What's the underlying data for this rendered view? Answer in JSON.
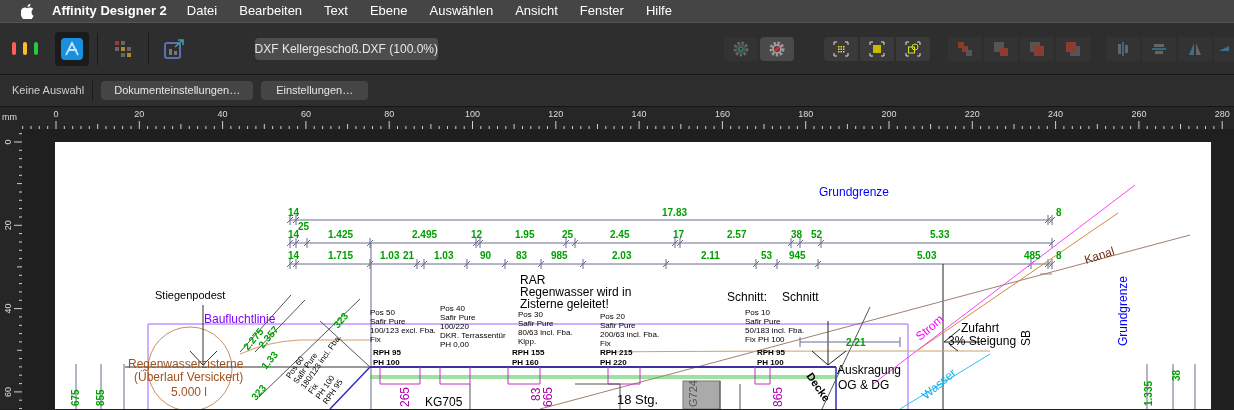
{
  "menu_bar": {
    "app_name": "Affinity Designer 2",
    "items": [
      "Datei",
      "Bearbeiten",
      "Text",
      "Ebene",
      "Auswählen",
      "Ansicht",
      "Fenster",
      "Hilfe"
    ]
  },
  "toolbar": {
    "personas": [
      {
        "selected": true
      },
      {
        "selected": false
      },
      {
        "selected": false
      }
    ],
    "document_title": "DXF Kellergeschoß.DXF (100.0%)",
    "snapping_buttons": [
      {
        "selected": false
      },
      {
        "selected": true
      }
    ]
  },
  "context_bar": {
    "status": "Keine Auswahl",
    "buttons": [
      "Dokumenteinstellungen…",
      "Einstellungen…"
    ]
  },
  "ruler": {
    "unit": "mm",
    "horizontal_labels": [
      "0",
      "20",
      "40",
      "60",
      "80",
      "100",
      "120",
      "140",
      "160",
      "180",
      "200",
      "220",
      "240",
      "260",
      "280"
    ],
    "vertical_labels": [
      "0",
      "20",
      "40",
      "60"
    ]
  },
  "drawing": {
    "labels": [
      {
        "text": "Grundgrenze",
        "color": "#0000ff"
      },
      {
        "text": "14",
        "color": "#00a000"
      },
      {
        "text": "17.83",
        "color": "#00a000"
      },
      {
        "text": "8",
        "color": "#00a000"
      },
      {
        "text": "25",
        "color": "#00a000"
      },
      {
        "text": "14",
        "color": "#00a000"
      },
      {
        "text": "1.425",
        "color": "#00a000"
      },
      {
        "text": "2.495",
        "color": "#00a000"
      },
      {
        "text": "12",
        "color": "#00a000"
      },
      {
        "text": "1.95",
        "color": "#00a000"
      },
      {
        "text": "25",
        "color": "#00a000"
      },
      {
        "text": "2.45",
        "color": "#00a000"
      },
      {
        "text": "17",
        "color": "#00a000"
      },
      {
        "text": "2.57",
        "color": "#00a000"
      },
      {
        "text": "38",
        "color": "#00a000"
      },
      {
        "text": "52",
        "color": "#00a000"
      },
      {
        "text": "5.33",
        "color": "#00a000"
      },
      {
        "text": "14",
        "color": "#00a000"
      },
      {
        "text": "1.715",
        "color": "#00a000"
      },
      {
        "text": "1.03",
        "color": "#00a000"
      },
      {
        "text": "21",
        "color": "#00a000"
      },
      {
        "text": "1.03",
        "color": "#00a000"
      },
      {
        "text": "90",
        "color": "#00a000"
      },
      {
        "text": "83",
        "color": "#00a000"
      },
      {
        "text": "985",
        "color": "#00a000"
      },
      {
        "text": "2.03",
        "color": "#00a000"
      },
      {
        "text": "2.11",
        "color": "#00a000"
      },
      {
        "text": "53",
        "color": "#00a000"
      },
      {
        "text": "945",
        "color": "#00a000"
      },
      {
        "text": "5.03",
        "color": "#00a000"
      },
      {
        "text": "485",
        "color": "#00a000"
      },
      {
        "text": "8",
        "color": "#00a000"
      },
      {
        "text": "Kanal",
        "color": "#6b2a10"
      },
      {
        "text": "Stiegenpodest",
        "color": "#000000"
      },
      {
        "text": "RAR",
        "color": "#000000"
      },
      {
        "text": "Regenwasser wird in",
        "color": "#000000"
      },
      {
        "text": "Zisterne geleitet!",
        "color": "#000000"
      },
      {
        "text": "Schnitt:",
        "color": "#000000"
      },
      {
        "text": "Schnitt",
        "color": "#000000"
      },
      {
        "text": "Grundgrenze",
        "color": "#0000ff"
      },
      {
        "text": "Baufluchtlinie",
        "color": "#8000ff"
      },
      {
        "text": "2.275",
        "color": "#00a000"
      },
      {
        "text": "2.357",
        "color": "#00a000"
      },
      {
        "text": "323",
        "color": "#00a000"
      },
      {
        "text": "1.33",
        "color": "#00a000"
      },
      {
        "text": "323",
        "color": "#00a000"
      },
      {
        "text": "RPH 95",
        "color": "#000000"
      },
      {
        "text": "PH 100",
        "color": "#000000"
      },
      {
        "text": "RPH 155",
        "color": "#000000"
      },
      {
        "text": "PH 160",
        "color": "#000000"
      },
      {
        "text": "RPH 215",
        "color": "#000000"
      },
      {
        "text": "PH 220",
        "color": "#000000"
      },
      {
        "text": "RPH 95",
        "color": "#000000"
      },
      {
        "text": "PH 100",
        "color": "#000000"
      },
      {
        "text": "2.21",
        "color": "#00a000"
      },
      {
        "text": "Strom",
        "color": "#ff00ff"
      },
      {
        "text": "Zufahrt",
        "color": "#000000"
      },
      {
        "text": "3% Steigung",
        "color": "#000000"
      },
      {
        "text": "SB",
        "color": "#000000"
      },
      {
        "text": "Regenwasserzisterne",
        "color": "#a0521c"
      },
      {
        "text": "(Überlauf Versickert)",
        "color": "#a0521c"
      },
      {
        "text": "5.000 l",
        "color": "#a0521c"
      },
      {
        "text": "Auskragung",
        "color": "#000000"
      },
      {
        "text": "OG & DG",
        "color": "#000000"
      },
      {
        "text": "Wasser",
        "color": "#00b0f0"
      },
      {
        "text": "KG705",
        "color": "#000000"
      },
      {
        "text": "18 Stg.",
        "color": "#000000"
      },
      {
        "text": "G724",
        "color": "#555555"
      },
      {
        "text": "265",
        "color": "#b000b0"
      },
      {
        "text": "83",
        "color": "#b000b0"
      },
      {
        "text": "665",
        "color": "#b000b0"
      },
      {
        "text": "865",
        "color": "#b000b0"
      },
      {
        "text": "1.335",
        "color": "#00a000"
      },
      {
        "text": "38",
        "color": "#00a000"
      },
      {
        "text": "675",
        "color": "#00a000"
      },
      {
        "text": "855",
        "color": "#00a000"
      },
      {
        "text": "Decke",
        "color": "#000000"
      }
    ],
    "window_notes": [
      {
        "lines": [
          "Pos 50",
          "Safir Pure",
          "100/123 excl. Fba.",
          "Fix"
        ]
      },
      {
        "lines": [
          "Pos 40",
          "Safir Pure",
          "100/220",
          "DKR. Terrassentür",
          "PH 0,00"
        ]
      },
      {
        "lines": [
          "Pos 30",
          "Safir Pure",
          "80/63 incl. Fba.",
          "Kipp."
        ]
      },
      {
        "lines": [
          "Pos 20",
          "Safir Pure",
          "200/63 incl. Fba.",
          "Fix"
        ]
      },
      {
        "lines": [
          "Pos 10",
          "Safir Pure",
          "50/183 incl. Fba.",
          "Fix PH 100"
        ]
      },
      {
        "lines": [
          "Pos 60",
          "Safir Pure",
          "180/123 incl. Fba.",
          "Fix",
          "PH 100",
          "RPH 95"
        ]
      }
    ]
  }
}
